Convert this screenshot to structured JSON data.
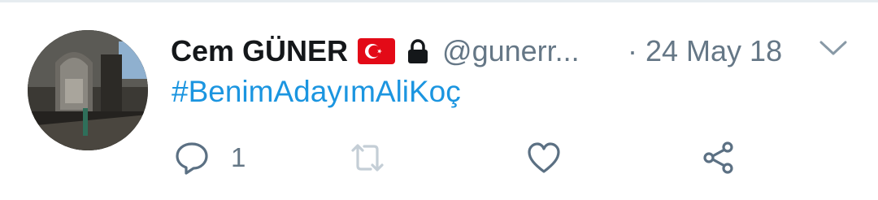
{
  "tweet": {
    "author_name": "Cem GÜNER",
    "handle": "@gunerr...",
    "timestamp": "· 24 May 18",
    "hashtag": "#BenimAdayımAliKoç"
  },
  "actions": {
    "reply_count": "1"
  },
  "icons": {
    "flag": "turkish-flag-icon",
    "lock": "lock-icon",
    "menu": "chevron-down-icon",
    "reply": "reply-icon",
    "retweet": "retweet-icon",
    "like": "heart-icon",
    "share": "share-icon"
  },
  "colors": {
    "text": "#14171a",
    "secondary": "#657786",
    "link": "#1b95e0",
    "icon": "#5b7083",
    "flag_red": "#e30a17"
  }
}
